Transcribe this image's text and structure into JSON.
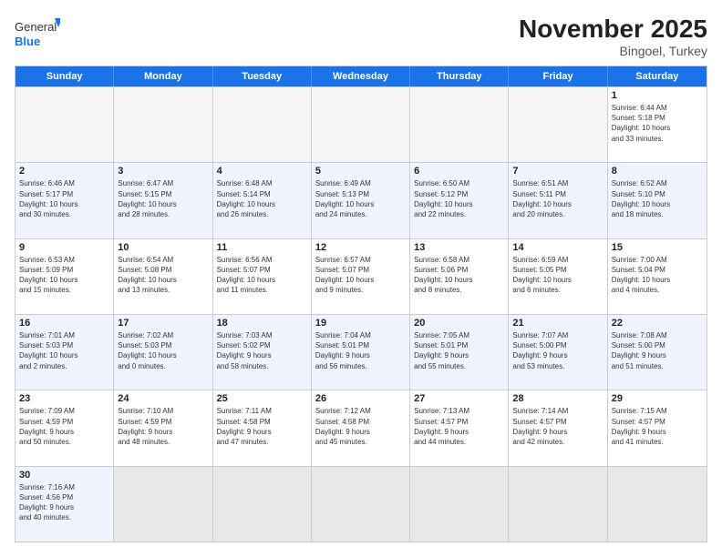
{
  "header": {
    "logo_general": "General",
    "logo_blue": "Blue",
    "month": "November 2025",
    "location": "Bingoel, Turkey"
  },
  "days": [
    "Sunday",
    "Monday",
    "Tuesday",
    "Wednesday",
    "Thursday",
    "Friday",
    "Saturday"
  ],
  "weeks": [
    [
      {
        "day": "",
        "info": ""
      },
      {
        "day": "",
        "info": ""
      },
      {
        "day": "",
        "info": ""
      },
      {
        "day": "",
        "info": ""
      },
      {
        "day": "",
        "info": ""
      },
      {
        "day": "",
        "info": ""
      },
      {
        "day": "1",
        "info": "Sunrise: 6:44 AM\nSunset: 5:18 PM\nDaylight: 10 hours\nand 33 minutes."
      }
    ],
    [
      {
        "day": "2",
        "info": "Sunrise: 6:46 AM\nSunset: 5:17 PM\nDaylight: 10 hours\nand 30 minutes."
      },
      {
        "day": "3",
        "info": "Sunrise: 6:47 AM\nSunset: 5:15 PM\nDaylight: 10 hours\nand 28 minutes."
      },
      {
        "day": "4",
        "info": "Sunrise: 6:48 AM\nSunset: 5:14 PM\nDaylight: 10 hours\nand 26 minutes."
      },
      {
        "day": "5",
        "info": "Sunrise: 6:49 AM\nSunset: 5:13 PM\nDaylight: 10 hours\nand 24 minutes."
      },
      {
        "day": "6",
        "info": "Sunrise: 6:50 AM\nSunset: 5:12 PM\nDaylight: 10 hours\nand 22 minutes."
      },
      {
        "day": "7",
        "info": "Sunrise: 6:51 AM\nSunset: 5:11 PM\nDaylight: 10 hours\nand 20 minutes."
      },
      {
        "day": "8",
        "info": "Sunrise: 6:52 AM\nSunset: 5:10 PM\nDaylight: 10 hours\nand 18 minutes."
      }
    ],
    [
      {
        "day": "9",
        "info": "Sunrise: 6:53 AM\nSunset: 5:09 PM\nDaylight: 10 hours\nand 15 minutes."
      },
      {
        "day": "10",
        "info": "Sunrise: 6:54 AM\nSunset: 5:08 PM\nDaylight: 10 hours\nand 13 minutes."
      },
      {
        "day": "11",
        "info": "Sunrise: 6:56 AM\nSunset: 5:07 PM\nDaylight: 10 hours\nand 11 minutes."
      },
      {
        "day": "12",
        "info": "Sunrise: 6:57 AM\nSunset: 5:07 PM\nDaylight: 10 hours\nand 9 minutes."
      },
      {
        "day": "13",
        "info": "Sunrise: 6:58 AM\nSunset: 5:06 PM\nDaylight: 10 hours\nand 8 minutes."
      },
      {
        "day": "14",
        "info": "Sunrise: 6:59 AM\nSunset: 5:05 PM\nDaylight: 10 hours\nand 6 minutes."
      },
      {
        "day": "15",
        "info": "Sunrise: 7:00 AM\nSunset: 5:04 PM\nDaylight: 10 hours\nand 4 minutes."
      }
    ],
    [
      {
        "day": "16",
        "info": "Sunrise: 7:01 AM\nSunset: 5:03 PM\nDaylight: 10 hours\nand 2 minutes."
      },
      {
        "day": "17",
        "info": "Sunrise: 7:02 AM\nSunset: 5:03 PM\nDaylight: 10 hours\nand 0 minutes."
      },
      {
        "day": "18",
        "info": "Sunrise: 7:03 AM\nSunset: 5:02 PM\nDaylight: 9 hours\nand 58 minutes."
      },
      {
        "day": "19",
        "info": "Sunrise: 7:04 AM\nSunset: 5:01 PM\nDaylight: 9 hours\nand 56 minutes."
      },
      {
        "day": "20",
        "info": "Sunrise: 7:05 AM\nSunset: 5:01 PM\nDaylight: 9 hours\nand 55 minutes."
      },
      {
        "day": "21",
        "info": "Sunrise: 7:07 AM\nSunset: 5:00 PM\nDaylight: 9 hours\nand 53 minutes."
      },
      {
        "day": "22",
        "info": "Sunrise: 7:08 AM\nSunset: 5:00 PM\nDaylight: 9 hours\nand 51 minutes."
      }
    ],
    [
      {
        "day": "23",
        "info": "Sunrise: 7:09 AM\nSunset: 4:59 PM\nDaylight: 9 hours\nand 50 minutes."
      },
      {
        "day": "24",
        "info": "Sunrise: 7:10 AM\nSunset: 4:59 PM\nDaylight: 9 hours\nand 48 minutes."
      },
      {
        "day": "25",
        "info": "Sunrise: 7:11 AM\nSunset: 4:58 PM\nDaylight: 9 hours\nand 47 minutes."
      },
      {
        "day": "26",
        "info": "Sunrise: 7:12 AM\nSunset: 4:58 PM\nDaylight: 9 hours\nand 45 minutes."
      },
      {
        "day": "27",
        "info": "Sunrise: 7:13 AM\nSunset: 4:57 PM\nDaylight: 9 hours\nand 44 minutes."
      },
      {
        "day": "28",
        "info": "Sunrise: 7:14 AM\nSunset: 4:57 PM\nDaylight: 9 hours\nand 42 minutes."
      },
      {
        "day": "29",
        "info": "Sunrise: 7:15 AM\nSunset: 4:57 PM\nDaylight: 9 hours\nand 41 minutes."
      }
    ],
    [
      {
        "day": "30",
        "info": "Sunrise: 7:16 AM\nSunset: 4:56 PM\nDaylight: 9 hours\nand 40 minutes."
      },
      {
        "day": "",
        "info": ""
      },
      {
        "day": "",
        "info": ""
      },
      {
        "day": "",
        "info": ""
      },
      {
        "day": "",
        "info": ""
      },
      {
        "day": "",
        "info": ""
      },
      {
        "day": "",
        "info": ""
      }
    ]
  ]
}
